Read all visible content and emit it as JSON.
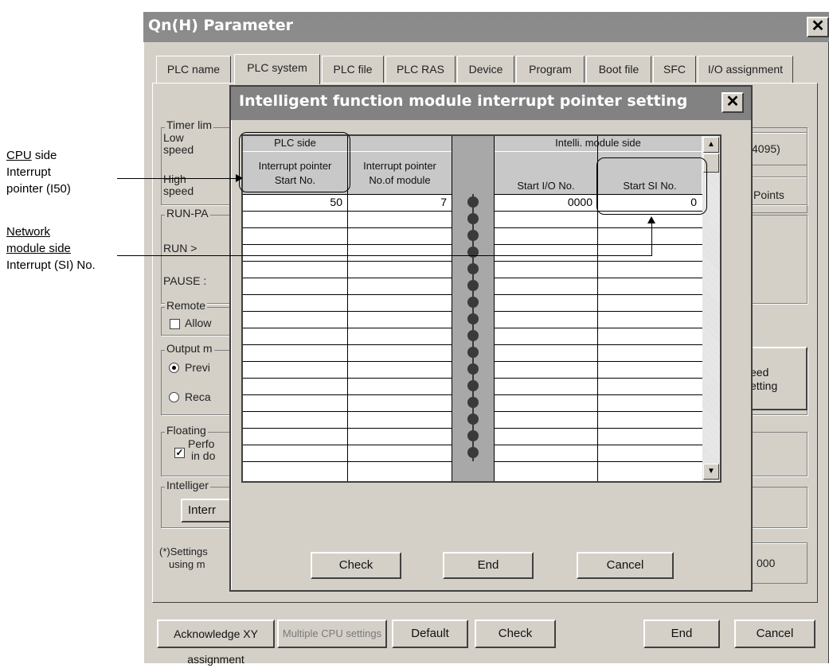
{
  "annotations": {
    "cpu_side_line1_u": "CPU",
    "cpu_side_line1_rest": " side",
    "cpu_side_line2": "Interrupt",
    "cpu_side_line3": "pointer (I50)",
    "network_line1": "Network",
    "network_line2": "module side",
    "network_line3": "Interrupt (SI) No."
  },
  "window": {
    "title": "Qn(H) Parameter",
    "close": "✕",
    "tabs": [
      "PLC name",
      "PLC system",
      "PLC file",
      "PLC RAS",
      "Device",
      "Program",
      "Boot file",
      "SFC",
      "I/O assignment"
    ],
    "active_tab": "PLC system",
    "panel": {
      "timer_group": "Timer lim",
      "low_speed_1": "Low",
      "low_speed_2": "speed",
      "high_speed_1": "High",
      "high_speed_2": "speed",
      "right_1": "4095)",
      "right_2": "Points",
      "runpause_group": "RUN-PA",
      "run": "RUN  >",
      "pause": "PAUSE :",
      "remote_group": "Remote",
      "allow": "Allow",
      "output_group": "Output m",
      "previ": "Previ",
      "reca": "Reca",
      "right_btn_1": "eed",
      "right_btn_2": "etting",
      "floating_group": "Floating",
      "perfo_1": "Perfo",
      "perfo_2": "in do",
      "intelligent_group": "Intelliger",
      "intern_btn": "Interr",
      "settings_1": "(*)Settings",
      "settings_2": "using m",
      "right_3": "000"
    },
    "buttons": {
      "ack": "Acknowledge XY assignment",
      "multi": "Multiple CPU settings",
      "default": "Default",
      "check": "Check",
      "end": "End",
      "cancel": "Cancel"
    }
  },
  "dialog": {
    "title": "Intelligent function module interrupt pointer setting",
    "close": "✕",
    "headers": {
      "plc_side": "PLC side",
      "intelli_side": "Intelli. module side",
      "col1_a": "Interrupt pointer",
      "col1_b": "Start No.",
      "col2_a": "Interrupt pointer",
      "col2_b": "No.of module",
      "col3": "Start I/O No.",
      "col4": "Start SI No."
    },
    "row1": [
      "50",
      "7",
      "0000",
      "0"
    ],
    "buttons": {
      "check": "Check",
      "end": "End",
      "cancel": "Cancel"
    }
  }
}
